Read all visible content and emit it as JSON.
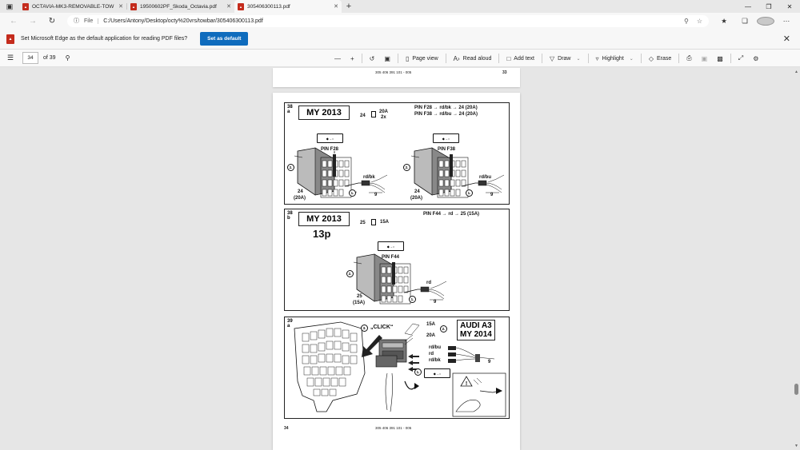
{
  "tabs": [
    {
      "title": "OCTAVIA-MK3-REMOVABLE-TOW",
      "active": false
    },
    {
      "title": "19500602PF_Skoda_Octavia.pdf",
      "active": false
    },
    {
      "title": "305406300113.pdf",
      "active": true
    }
  ],
  "address": {
    "file_label": "File",
    "url": "C:/Users/Antony/Desktop/octy%20vrs/towbar/305406300113.pdf"
  },
  "infobar": {
    "message": "Set Microsoft Edge as the default application for reading PDF files?",
    "button": "Set as default"
  },
  "pdf_toolbar": {
    "page_current": "34",
    "page_total": "of 39",
    "tools": {
      "page_view": "Page view",
      "read_aloud": "Read aloud",
      "add_text": "Add text",
      "draw": "Draw",
      "highlight": "Highlight",
      "erase": "Erase"
    }
  },
  "doc": {
    "top_page": {
      "code": "305 406 391 101 - 005",
      "number": "33"
    },
    "page": {
      "code": "305 406 391 101 - 005",
      "number": "34"
    },
    "panel1": {
      "step": "38",
      "sub": "a",
      "my": "MY 2013",
      "fuse_num": "24",
      "fuse_amp": "20A",
      "fuse_qty": "2x",
      "pin_line1": "PIN F28 → rd/bk → 24 (20A)",
      "pin_line2": "PIN F38 → rd/bu → 24 (20A)",
      "pin_left": "PIN F28",
      "pin_right": "PIN F38",
      "wire_left": "rd/bk",
      "wire_right": "rd/bu",
      "fuse_left": "24",
      "fuse_left_amp": "(20A)",
      "fuse_right": "24",
      "fuse_right_amp": "(20A)",
      "nine_left": "9",
      "nine_right": "9",
      "c1": "1.",
      "c2": "2."
    },
    "panel2": {
      "step": "38",
      "sub": "b",
      "my": "MY 2013",
      "p13": "13p",
      "fuse_num": "25",
      "fuse_amp": "15A",
      "pin_line": "PIN F44 → rd → 25 (15A)",
      "pin": "PIN F44",
      "wire": "rd",
      "fuse": "25",
      "fuse_amp2": "(15A)",
      "nine": "9",
      "c1": "1.",
      "c2": "2."
    },
    "panel3": {
      "step": "39",
      "sub": "a",
      "click": "„CLICK“",
      "amp1": "15A",
      "amp2": "20A",
      "w1": "rd/bu",
      "w2": "rd",
      "w3": "rd/bk",
      "audi1": "AUDI A3",
      "audi2": "MY 2014",
      "nine": "9",
      "c1": "1.",
      "c2": "2.",
      "c3": "3."
    }
  },
  "colors": {
    "accent": "#0f6cbd",
    "pdf_red": "#c42b1c"
  }
}
